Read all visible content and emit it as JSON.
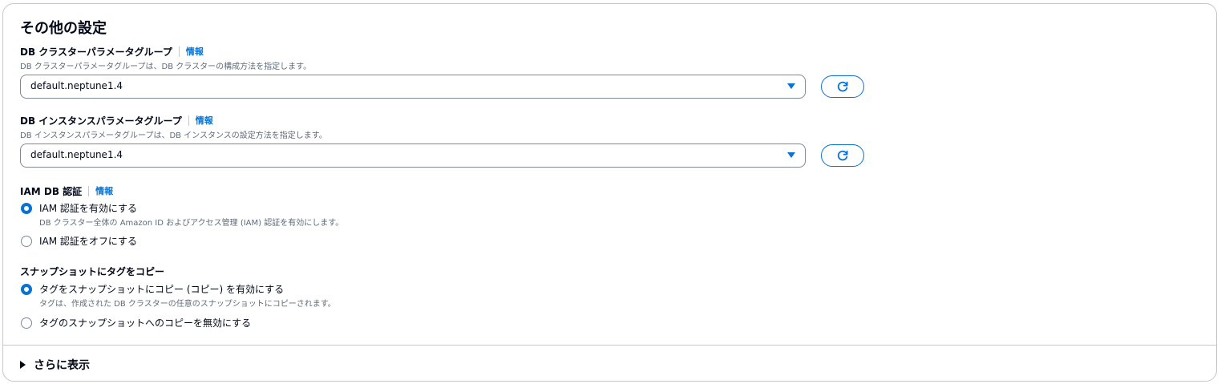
{
  "section": {
    "title": "その他の設定"
  },
  "cluster_param_group": {
    "label": "DB クラスターパラメータグループ",
    "info": "情報",
    "description": "DB クラスターパラメータグループは、DB クラスターの構成方法を指定します。",
    "selected": "default.neptune1.4"
  },
  "instance_param_group": {
    "label": "DB インスタンスパラメータグループ",
    "info": "情報",
    "description": "DB インスタンスパラメータグループは、DB インスタンスの設定方法を指定します。",
    "selected": "default.neptune1.4"
  },
  "iam_auth": {
    "label": "IAM DB 認証",
    "info": "情報",
    "options": [
      {
        "label": "IAM 認証を有効にする",
        "description": "DB クラスター全体の Amazon ID およびアクセス管理 (IAM) 認証を有効にします。",
        "checked": true
      },
      {
        "label": "IAM 認証をオフにする",
        "checked": false
      }
    ]
  },
  "copy_tags": {
    "label": "スナップショットにタグをコピー",
    "options": [
      {
        "label": "タグをスナップショットにコピー (コピー) を有効にする",
        "description": "タグは、作成された DB クラスターの任意のスナップショットにコピーされます。",
        "checked": true
      },
      {
        "label": "タグのスナップショットへのコピーを無効にする",
        "checked": false
      }
    ]
  },
  "expand": {
    "label": "さらに表示"
  },
  "colors": {
    "accent": "#0972d3",
    "text": "#000716",
    "muted": "#5f6b7a",
    "border": "#c6c6cd"
  }
}
